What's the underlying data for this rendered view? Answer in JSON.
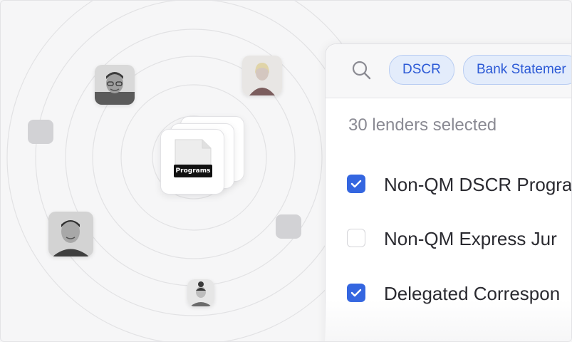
{
  "orbit": {
    "center_label": "Programs",
    "avatars": [
      {
        "name": "man-glasses",
        "shade": "#8a8a8a"
      },
      {
        "name": "woman-blonde",
        "shade": "#b9b1ad"
      },
      {
        "name": "man-suit",
        "shade": "#6f6f6f"
      },
      {
        "name": "woman-small",
        "shade": "#9a9a9a"
      }
    ]
  },
  "filters": {
    "chips": [
      "DSCR",
      "Bank Statemer"
    ]
  },
  "lenders": {
    "selected_count_text": "30 lenders selected",
    "items": [
      {
        "label": "Non-QM DSCR Progra",
        "checked": true
      },
      {
        "label": "Non-QM Express Jur",
        "checked": false
      },
      {
        "label": "Delegated Correspon",
        "checked": true
      }
    ]
  },
  "colors": {
    "accent": "#3466e0",
    "chip_bg": "#e3ecfb",
    "chip_text": "#2c5ad6",
    "background": "#f6f6f7"
  }
}
